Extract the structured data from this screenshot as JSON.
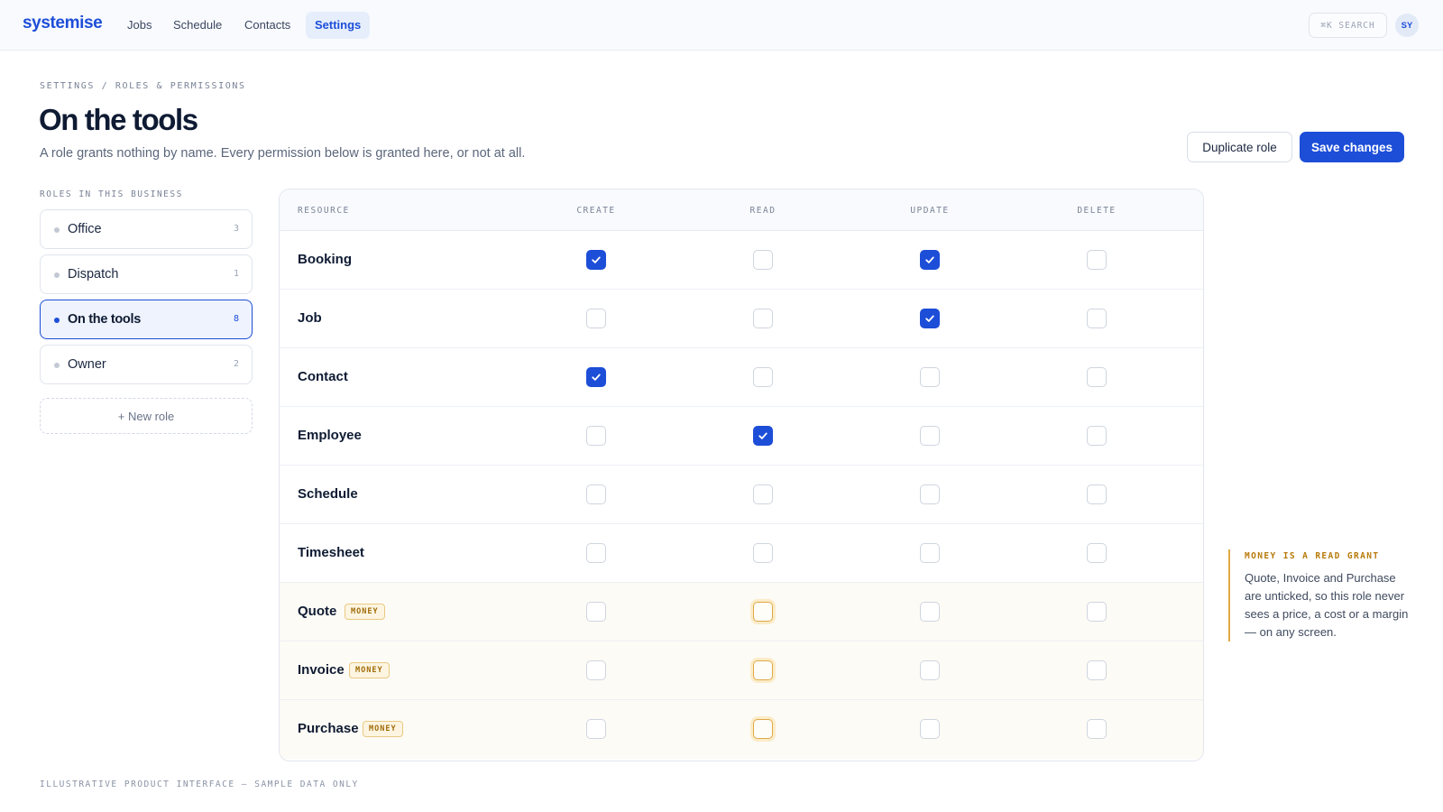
{
  "nav": {
    "brand": "systemise",
    "items": [
      {
        "label": "Jobs",
        "active": false
      },
      {
        "label": "Schedule",
        "active": false
      },
      {
        "label": "Contacts",
        "active": false
      },
      {
        "label": "Settings",
        "active": true
      }
    ],
    "search_label": "⌘K SEARCH",
    "avatar_initials": "SY"
  },
  "header": {
    "breadcrumb": "SETTINGS / ROLES & PERMISSIONS",
    "title": "On the tools",
    "subtitle": "A role grants nothing by name. Every permission below is granted here, or not at all.",
    "duplicate_label": "Duplicate role",
    "save_label": "Save changes"
  },
  "roles": {
    "label": "ROLES IN THIS BUSINESS",
    "items": [
      {
        "name": "Office",
        "count": "3",
        "active": false
      },
      {
        "name": "Dispatch",
        "count": "1",
        "active": false
      },
      {
        "name": "On the tools",
        "count": "8",
        "active": true
      },
      {
        "name": "Owner",
        "count": "2",
        "active": false
      }
    ],
    "new_role_label": "+ New role"
  },
  "table": {
    "columns": [
      "RESOURCE",
      "CREATE",
      "READ",
      "UPDATE",
      "DELETE"
    ],
    "rows": [
      {
        "resource": "Booking",
        "money": false,
        "perms": [
          true,
          false,
          true,
          false
        ]
      },
      {
        "resource": "Job",
        "money": false,
        "perms": [
          false,
          false,
          true,
          false
        ]
      },
      {
        "resource": "Contact",
        "money": false,
        "perms": [
          true,
          false,
          false,
          false
        ]
      },
      {
        "resource": "Employee",
        "money": false,
        "perms": [
          false,
          true,
          false,
          false
        ]
      },
      {
        "resource": "Schedule",
        "money": false,
        "perms": [
          false,
          false,
          false,
          false
        ]
      },
      {
        "resource": "Timesheet",
        "money": false,
        "perms": [
          false,
          false,
          false,
          false
        ]
      },
      {
        "resource": "Quote",
        "money": true,
        "perms": [
          false,
          false,
          false,
          false
        ]
      },
      {
        "resource": "Invoice",
        "money": true,
        "perms": [
          false,
          false,
          false,
          false
        ]
      },
      {
        "resource": "Purchase",
        "money": true,
        "perms": [
          false,
          false,
          false,
          false
        ]
      }
    ],
    "money_badge": "MONEY"
  },
  "callout": {
    "title": "MONEY IS A READ GRANT",
    "body": "Quote, Invoice and Purchase are unticked, so this role never sees a price, a cost or a margin — on any screen."
  },
  "footer_note": "ILLUSTRATIVE PRODUCT INTERFACE — SAMPLE DATA ONLY",
  "colors": {
    "accent": "#1d4ed8",
    "money": "#e0a847"
  }
}
